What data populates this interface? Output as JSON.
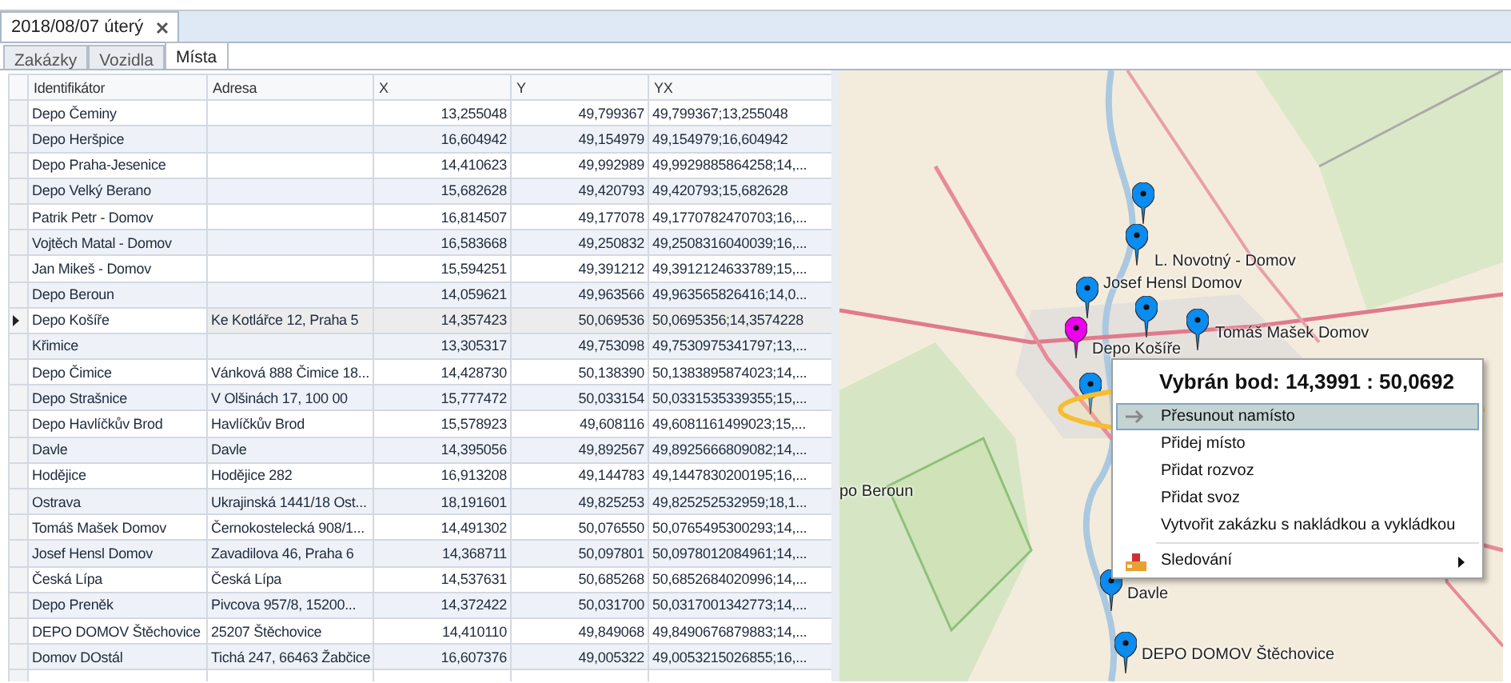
{
  "document_tabs": [
    {
      "label": "2018/08/07 úterý",
      "selected": true
    }
  ],
  "tabs": [
    {
      "label": "Zakázky",
      "selected": false
    },
    {
      "label": "Vozidla",
      "selected": false
    },
    {
      "label": "Místa",
      "selected": true
    }
  ],
  "table": {
    "columns": [
      "Identifikátor",
      "Adresa",
      "X",
      "Y",
      "YX"
    ],
    "rows": [
      {
        "cells": [
          "Depo Čeminy",
          "",
          "13,255048",
          "49,799367",
          "49,799367;13,255048"
        ],
        "selected": false
      },
      {
        "cells": [
          "Depo Heršpice",
          "",
          "16,604942",
          "49,154979",
          "49,154979;16,604942"
        ],
        "selected": false
      },
      {
        "cells": [
          "Depo Praha-Jesenice",
          "",
          "14,410623",
          "49,992989",
          "49,9929885864258;14,..."
        ],
        "selected": false
      },
      {
        "cells": [
          "Depo Velký Berano",
          "",
          "15,682628",
          "49,420793",
          "49,420793;15,682628"
        ],
        "selected": false
      },
      {
        "cells": [
          "Patrik Petr - Domov",
          "",
          "16,814507",
          "49,177078",
          "49,1770782470703;16,..."
        ],
        "selected": false
      },
      {
        "cells": [
          "Vojtěch Matal - Domov",
          "",
          "16,583668",
          "49,250832",
          "49,2508316040039;16,..."
        ],
        "selected": false
      },
      {
        "cells": [
          "Jan Mikeš - Domov",
          "",
          "15,594251",
          "49,391212",
          "49,3912124633789;15,..."
        ],
        "selected": false
      },
      {
        "cells": [
          "Depo Beroun",
          "",
          "14,059621",
          "49,963566",
          "49,963565826416;14,0..."
        ],
        "selected": false
      },
      {
        "cells": [
          "Depo Košíře",
          "Ke Kotlářce 12, Praha 5",
          "14,357423",
          "50,069536",
          "50,0695356;14,3574228"
        ],
        "selected": true
      },
      {
        "cells": [
          "Křimice",
          "",
          "13,305317",
          "49,753098",
          "49,7530975341797;13,..."
        ],
        "selected": false
      },
      {
        "cells": [
          "Depo Čimice",
          "Vánková 888  Čimice 18...",
          "14,428730",
          "50,138390",
          "50,1383895874023;14,..."
        ],
        "selected": false
      },
      {
        "cells": [
          "Depo Strašnice",
          "V Olšinách 17, 100 00",
          "15,777472",
          "50,033154",
          "50,0331535339355;15,..."
        ],
        "selected": false
      },
      {
        "cells": [
          "Depo Havlíčkův Brod",
          "Havlíčkův Brod",
          "15,578923",
          "49,608116",
          "49,6081161499023;15,..."
        ],
        "selected": false
      },
      {
        "cells": [
          "Davle",
          "Davle",
          "14,395056",
          "49,892567",
          "49,8925666809082;14,..."
        ],
        "selected": false
      },
      {
        "cells": [
          "Hodějice",
          "Hodějice 282",
          "16,913208",
          "49,144783",
          "49,1447830200195;16,..."
        ],
        "selected": false
      },
      {
        "cells": [
          "Ostrava",
          "Ukrajinská 1441/18 Ost...",
          "18,191601",
          "49,825253",
          "49,825252532959;18,1..."
        ],
        "selected": false
      },
      {
        "cells": [
          "Tomáš Mašek Domov",
          "Černokostelecká 908/1...",
          "14,491302",
          "50,076550",
          "50,0765495300293;14,..."
        ],
        "selected": false
      },
      {
        "cells": [
          "Josef Hensl Domov",
          "Zavadilova 46, Praha 6",
          "14,368711",
          "50,097801",
          "50,0978012084961;14,..."
        ],
        "selected": false
      },
      {
        "cells": [
          "Česká Lípa",
          "Česká Lípa",
          "14,537631",
          "50,685268",
          "50,6852684020996;14,..."
        ],
        "selected": false
      },
      {
        "cells": [
          "Depo Preněk",
          "Pivcova 957/8, 15200...",
          "14,372422",
          "50,031700",
          "50,0317001342773;14,..."
        ],
        "selected": false
      },
      {
        "cells": [
          "DEPO DOMOV Štěchovice",
          "25207 Štěchovice",
          "14,410110",
          "49,849068",
          "49,8490676879883;14,..."
        ],
        "selected": false
      },
      {
        "cells": [
          "Domov DOstál",
          "Tichá 247, 66463 Žabčice",
          "16,607376",
          "49,005322",
          "49,0053215026855;16,..."
        ],
        "selected": false
      }
    ]
  },
  "map": {
    "pins": [
      {
        "kind": "pin",
        "color": "#0a8cf0"
      },
      {
        "kind": "pin",
        "color": "#0a8cf0",
        "label": "L. Novotný - Domov"
      },
      {
        "kind": "pin",
        "color": "#0a8cf0",
        "label": "Josef Hensl Domov"
      },
      {
        "kind": "pin",
        "color": "#0a8cf0"
      },
      {
        "kind": "pin",
        "color": "#ee00ee",
        "label": "Depo Košíře"
      },
      {
        "kind": "pin",
        "color": "#0a8cf0",
        "label": "Tomáš Mašek Domov"
      },
      {
        "kind": "pin",
        "color": "#0a8cf0"
      },
      {
        "kind": "pin",
        "color": "#0a8cf0",
        "label": "Davle"
      },
      {
        "kind": "pin",
        "color": "#0a8cf0",
        "label": "DEPO DOMOV Štěchovice"
      },
      {
        "kind": "label",
        "label": "po Beroun"
      }
    ],
    "context_menu": {
      "title": "Vybrán bod: 14,3991 : 50,0692",
      "items": [
        {
          "kind": "item",
          "label": "Přesunout namísto",
          "selected": true,
          "icon": true
        },
        {
          "kind": "item",
          "label": "Přidej místo",
          "selected": false
        },
        {
          "kind": "item",
          "label": "Přidat rozvoz",
          "selected": false
        },
        {
          "kind": "item",
          "label": "Přidat svoz",
          "selected": false
        },
        {
          "kind": "item",
          "label": "Vytvořit zakázku s nakládkou a vykládkou",
          "selected": false
        },
        {
          "kind": "separator"
        },
        {
          "kind": "submenu",
          "label": "Sledování",
          "selected": false,
          "icon": true
        }
      ]
    }
  }
}
